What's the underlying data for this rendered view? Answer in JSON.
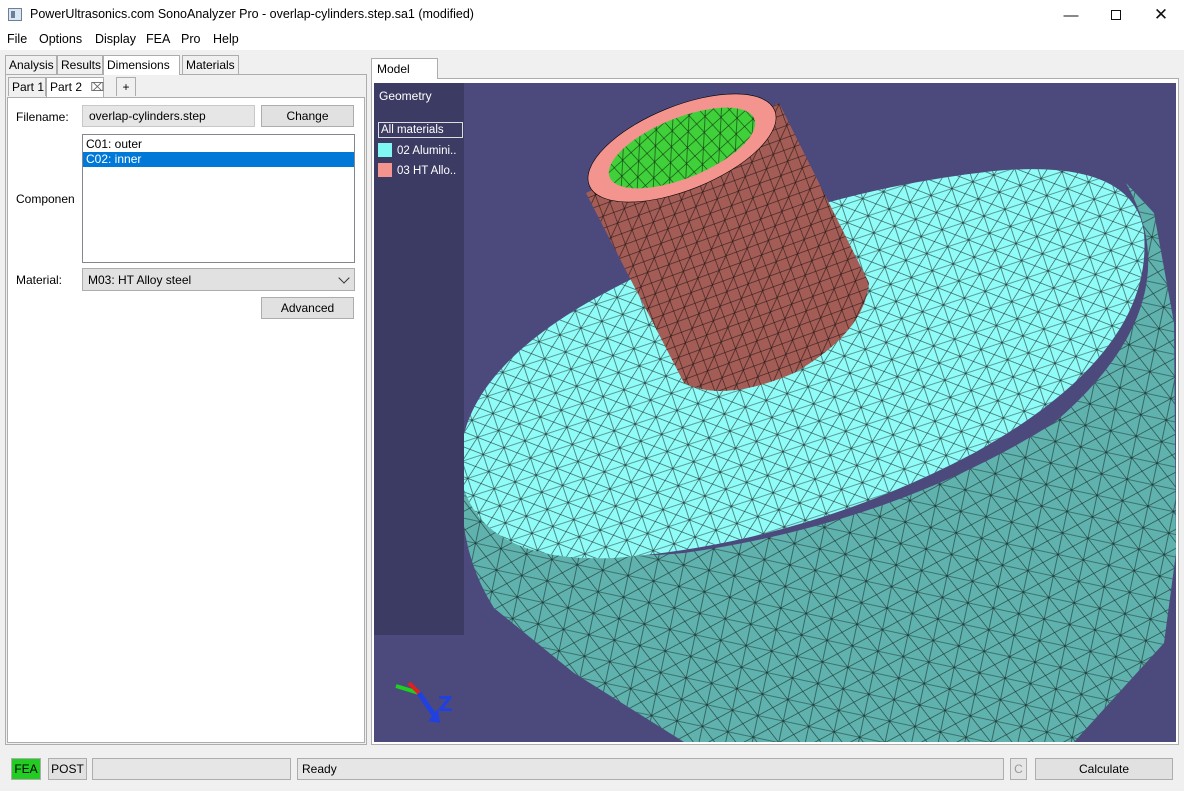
{
  "window": {
    "title": "PowerUltrasonics.com SonoAnalyzer Pro - overlap-cylinders.step.sa1 (modified)"
  },
  "menu": [
    "File",
    "Options",
    "Display",
    "FEA",
    "Pro",
    "Help"
  ],
  "left": {
    "tabs": [
      "Analysis",
      "Results",
      "Dimensions",
      "Materials"
    ],
    "active_tab": "Dimensions",
    "subtabs": [
      "Part 1",
      "Part 2",
      "+"
    ],
    "active_subtab": "Part 2",
    "filename_label": "Filename:",
    "filename_value": "overlap-cylinders.step",
    "change_label": "Change",
    "components_label": "Componen",
    "components": [
      "C01: outer",
      "C02: inner"
    ],
    "selected_component": "C02: inner",
    "material_label": "Material:",
    "material_value": "M03: HT Alloy steel",
    "advanced_label": "Advanced"
  },
  "right": {
    "tab": "Model",
    "geometry_title": "Geometry",
    "all_materials": "All materials",
    "legend": [
      {
        "label": "02 Alumini..",
        "color": "#7ff8f4"
      },
      {
        "label": "03 HT Allo..",
        "color": "#f3948e"
      }
    ],
    "axis_labels": [
      "Z"
    ]
  },
  "colors": {
    "viewport_bg": "#4c4a7c",
    "disc_top": "#8ffcf7",
    "disc_side": "#5fb2ad",
    "cylinder": "#a35d56",
    "cylinder_top": "#3fd03a",
    "fea_active": "#22cc22"
  },
  "status": {
    "fea": "FEA",
    "post": "POST",
    "message": "Ready",
    "c": "C",
    "calculate": "Calculate"
  }
}
